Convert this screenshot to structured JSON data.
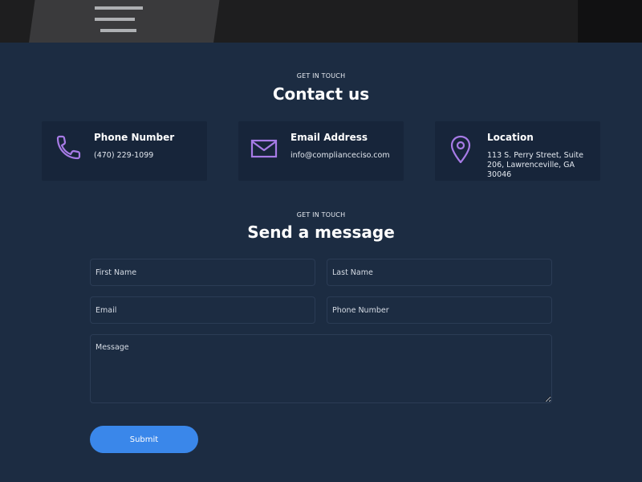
{
  "contact": {
    "eyebrow": "GET IN TOUCH",
    "title": "Contact us",
    "cards": [
      {
        "icon": "phone-icon",
        "title": "Phone Number",
        "value": "(470) 229-1099"
      },
      {
        "icon": "mail-icon",
        "title": "Email Address",
        "value": "info@complianceciso.com"
      },
      {
        "icon": "location-pin-icon",
        "title": "Location",
        "value": "113 S. Perry Street, Suite 206, Lawrenceville, GA 30046"
      }
    ]
  },
  "form": {
    "eyebrow": "GET IN TOUCH",
    "title": "Send a message",
    "first_name_placeholder": "First Name",
    "last_name_placeholder": "Last Name",
    "email_placeholder": "Email",
    "phone_placeholder": "Phone Number",
    "message_placeholder": "Message",
    "submit_label": "Submit"
  },
  "colors": {
    "background": "#1c2c42",
    "card_background": "#17253a",
    "icon_accent": "#a77be6",
    "button": "#3a87ea"
  }
}
